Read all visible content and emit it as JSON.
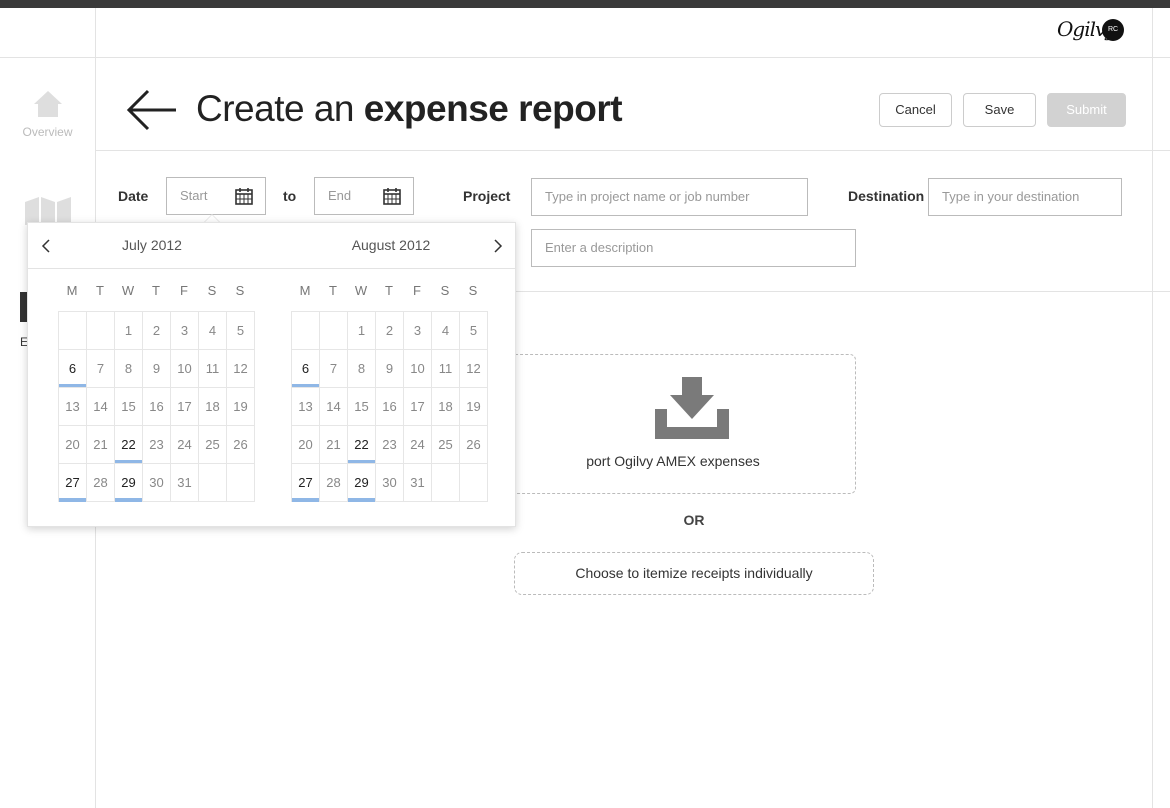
{
  "sidebar": {
    "items": [
      {
        "label": "Overview",
        "icon": "home-icon"
      },
      {
        "label": "",
        "icon": "map-icon"
      },
      {
        "label": "E",
        "icon": "expenses-icon"
      }
    ]
  },
  "header": {
    "logo": "Ogilvy",
    "avatar_initials": "RC"
  },
  "page": {
    "title_light": "Create an",
    "title_bold": "expense report"
  },
  "actions": {
    "cancel": "Cancel",
    "save": "Save",
    "submit": "Submit"
  },
  "form": {
    "date_label": "Date",
    "start_placeholder": "Start",
    "to_label": "to",
    "end_placeholder": "End",
    "project_label": "Project",
    "project_placeholder": "Type in project name or job number",
    "destination_label": "Destination",
    "destination_placeholder": "Type in your destination",
    "description_placeholder": "Enter a description"
  },
  "import": {
    "label": "port Ogilvy AMEX expenses",
    "or": "OR",
    "itemize": "Choose to itemize receipts individually"
  },
  "calendar": {
    "weekdays": [
      "M",
      "T",
      "W",
      "T",
      "F",
      "S",
      "S"
    ],
    "months": [
      {
        "title": "July 2012",
        "offset": 2,
        "days": 31,
        "highlight": [
          6,
          22,
          27,
          29
        ]
      },
      {
        "title": "August 2012",
        "offset": 2,
        "days": 31,
        "highlight": [
          6,
          22,
          27,
          29
        ]
      }
    ]
  },
  "colors": {
    "highlight": "#8fb7e6",
    "submit_bg": "#d2d2d2"
  }
}
